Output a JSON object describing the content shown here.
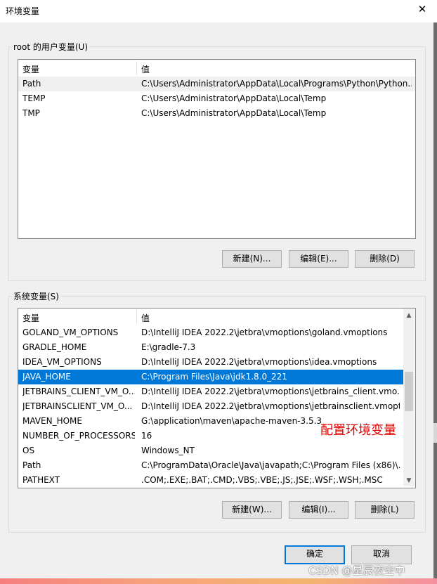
{
  "window": {
    "title": "环境变量",
    "close_glyph": "✕"
  },
  "user_vars": {
    "legend": "root 的用户变量(U)",
    "col_name": "变量",
    "col_value": "值",
    "rows": [
      {
        "name": "Path",
        "value": "C:\\Users\\Administrator\\AppData\\Local\\Programs\\Python\\Python..."
      },
      {
        "name": "TEMP",
        "value": "C:\\Users\\Administrator\\AppData\\Local\\Temp"
      },
      {
        "name": "TMP",
        "value": "C:\\Users\\Administrator\\AppData\\Local\\Temp"
      }
    ],
    "buttons": {
      "new": "新建(N)...",
      "edit": "编辑(E)...",
      "delete": "删除(D)"
    }
  },
  "system_vars": {
    "legend": "系统变量(S)",
    "col_name": "变量",
    "col_value": "值",
    "selected_index": 3,
    "rows": [
      {
        "name": "GOLAND_VM_OPTIONS",
        "value": "D:\\IntelliJ IDEA 2022.2\\jetbra\\vmoptions\\goland.vmoptions"
      },
      {
        "name": "GRADLE_HOME",
        "value": "E:\\gradle-7.3"
      },
      {
        "name": "IDEA_VM_OPTIONS",
        "value": "D:\\IntelliJ IDEA 2022.2\\jetbra\\vmoptions\\idea.vmoptions"
      },
      {
        "name": "JAVA_HOME",
        "value": "C:\\Program Files\\Java\\jdk1.8.0_221"
      },
      {
        "name": "JETBRAINS_CLIENT_VM_O...",
        "value": "D:\\IntelliJ IDEA 2022.2\\jetbra\\vmoptions\\jetbrains_client.vmo..."
      },
      {
        "name": "JETBRAINSCLIENT_VM_O...",
        "value": "D:\\IntelliJ IDEA 2022.2\\jetbra\\vmoptions\\jetbrainsclient.vmopt..."
      },
      {
        "name": "MAVEN_HOME",
        "value": "G:\\application\\maven\\apache-maven-3.5.3"
      },
      {
        "name": "NUMBER_OF_PROCESSORS",
        "value": "16"
      },
      {
        "name": "OS",
        "value": "Windows_NT"
      },
      {
        "name": "Path",
        "value": "C:\\ProgramData\\Oracle\\Java\\javapath;C:\\Program Files (x86)\\..."
      },
      {
        "name": "PATHEXT",
        "value": ".COM;.EXE;.BAT;.CMD;.VBS;.VBE;.JS;.JSE;.WSF;.WSH;.MSC"
      }
    ],
    "buttons": {
      "new": "新建(W)...",
      "edit": "编辑(I)...",
      "delete": "删除(L)"
    },
    "scroll": {
      "up_glyph": "▲",
      "down_glyph": "▼",
      "position": 0.45
    }
  },
  "footer": {
    "ok": "确定",
    "cancel": "取消"
  },
  "annotation": "配置环境变量",
  "watermark": "CSDN @星辰夜空中",
  "colors": {
    "selection": "#0078d7",
    "annotation": "#e00000",
    "default_button_border": "#0078d7"
  }
}
